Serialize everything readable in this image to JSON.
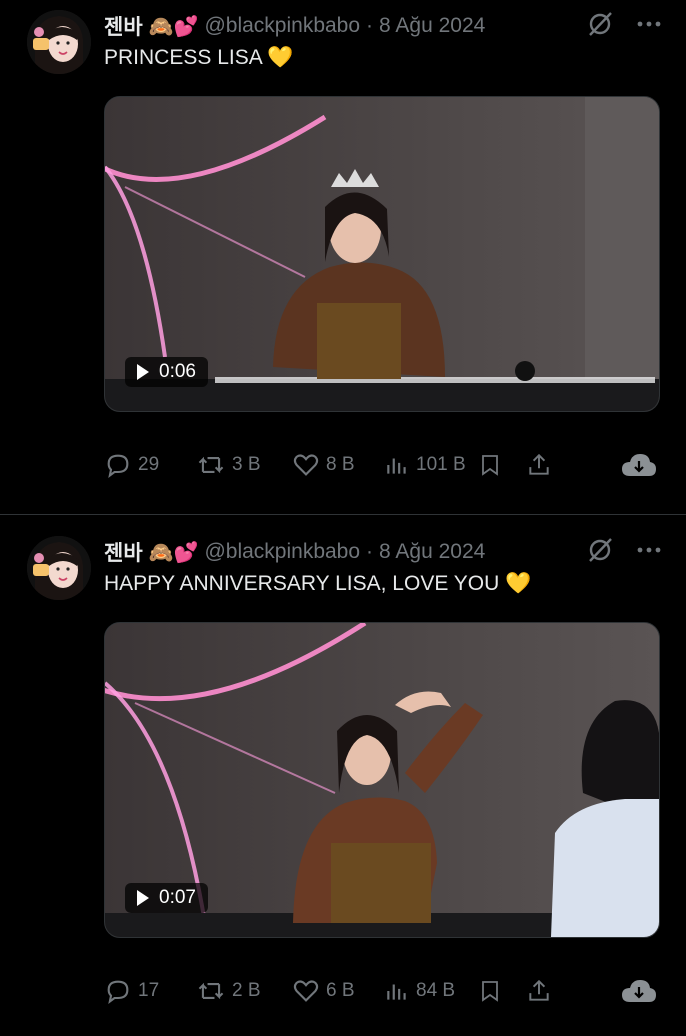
{
  "tweets": [
    {
      "author_name": "젠바",
      "author_emojis": "🙈💕",
      "handle": "@blackpinkbabo",
      "separator": "·",
      "date": "8 Ağu 2024",
      "text": "PRINCESS LISA",
      "text_emoji": "💛",
      "video_duration": "0:06",
      "replies": "29",
      "retweets": "3 B",
      "likes": "8 B",
      "views": "101 B"
    },
    {
      "author_name": "젠바",
      "author_emojis": "🙈💕",
      "handle": "@blackpinkbabo",
      "separator": "·",
      "date": "8 Ağu 2024",
      "text": "HAPPY ANNIVERSARY LISA, LOVE YOU",
      "text_emoji": "💛",
      "video_duration": "0:07",
      "replies": "17",
      "retweets": "2 B",
      "likes": "6 B",
      "views": "84 B"
    }
  ],
  "icons": {
    "reply": "reply-icon",
    "retweet": "retweet-icon",
    "like": "heart-icon",
    "views": "views-icon",
    "bookmark": "bookmark-icon",
    "share": "share-icon",
    "download": "download-cloud-icon",
    "grok": "grok-icon",
    "more": "more-icon"
  },
  "colors": {
    "background": "#000000",
    "text": "#e7e9ea",
    "muted": "#71767b",
    "divider": "#2f3336",
    "emoji_heart": "#f7c94b"
  }
}
